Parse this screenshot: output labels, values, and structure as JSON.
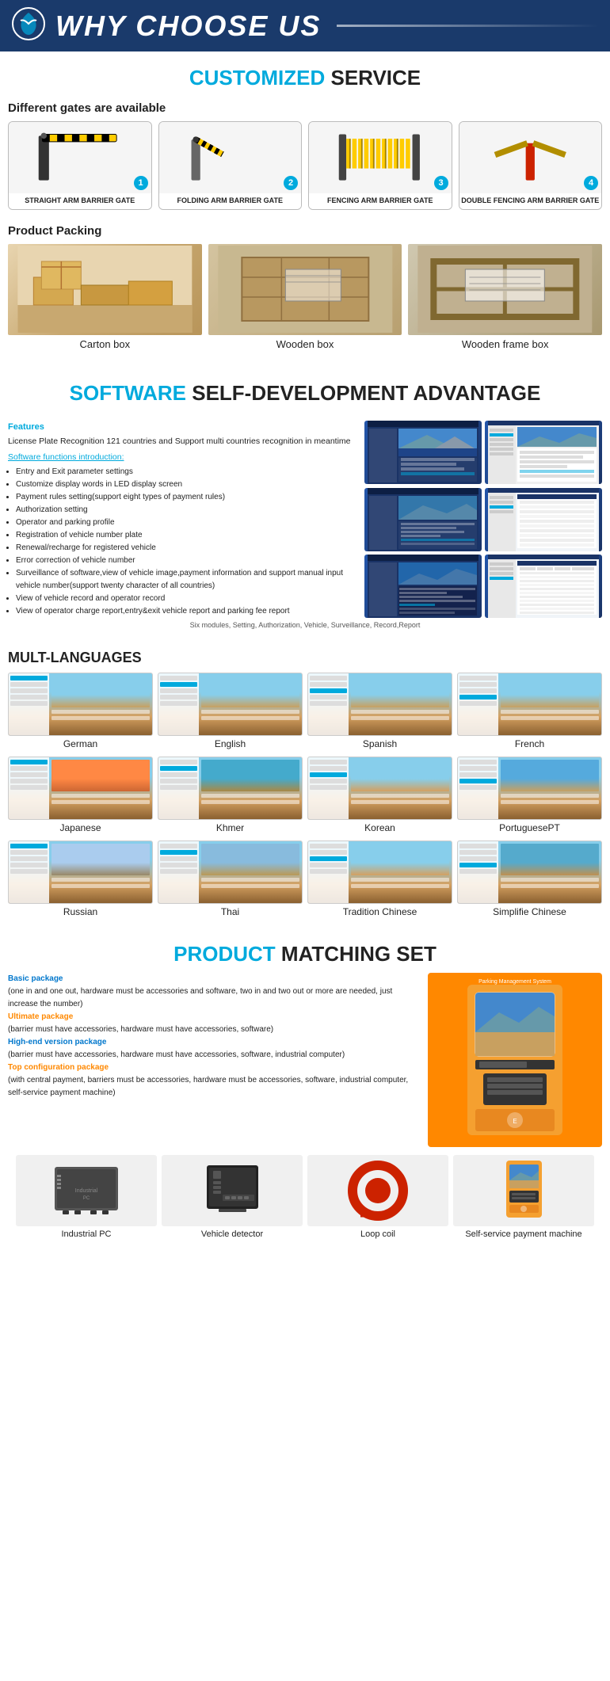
{
  "header": {
    "title": "WHY CHOOSE US",
    "logo_alt": "logo-icon"
  },
  "customized_service": {
    "section_title_highlight": "CUSTOMIZED",
    "section_title_normal": " SERVICE",
    "sub_title": "Different gates are available",
    "gates": [
      {
        "num": "1",
        "label": "STRAIGHT ARM BARRIER GATE"
      },
      {
        "num": "2",
        "label": "FOLDING ARM BARRIER GATE"
      },
      {
        "num": "3",
        "label": "FENCING ARM BARRIER GATE"
      },
      {
        "num": "4",
        "label": "DOUBLE FENCING ARM BARRIER GATE"
      }
    ],
    "packing_title": "Product Packing",
    "packing_items": [
      {
        "label": "Carton box"
      },
      {
        "label": "Wooden box"
      },
      {
        "label": "Wooden frame box"
      }
    ]
  },
  "software": {
    "section_title_highlight": "SOFTWARE",
    "section_title_normal": " SELF-DEVELOPMENT ADVANTAGE",
    "features_title": "Features",
    "features_desc": "License Plate Recognition 121 countries and Support multi countries recognition in meantime",
    "intro_label": "Software functions introduction:",
    "functions": [
      "Entry and Exit parameter settings",
      "Customize display words in LED display screen",
      "Payment rules setting(support eight types of payment rules)",
      "Authorization setting",
      "Operator and parking profile",
      "Registration of vehicle number plate",
      "Renewal/recharge for registered vehicle",
      "Error correction of vehicle number",
      "Surveillance of software,view of vehicle image,payment information and support manual input vehicle number(support twenty character of all countries)",
      "View of vehicle record and operator record",
      "View of operator charge report,entry&exit vehicle report and parking fee report"
    ],
    "caption": "Six modules, Setting, Authorization, Vehicle, Surveillance, Record,Report"
  },
  "languages": {
    "section_title": "MULT-LANGUAGES",
    "items": [
      "German",
      "English",
      "Spanish",
      "French",
      "Japanese",
      "Khmer",
      "Korean",
      "PortuguesePT",
      "Russian",
      "Thai",
      "Tradition Chinese",
      "Simplifie Chinese"
    ]
  },
  "product_matching": {
    "section_title_highlight": "PRODUCT",
    "section_title_normal": " MATCHING SET",
    "packages": [
      {
        "title": "Basic package",
        "color": "blue",
        "desc": "(one in and one out, hardware must be accessories and software, two in and two out or more are needed, just increase the number)"
      },
      {
        "title": "Ultimate package",
        "color": "orange",
        "desc": "(barrier must have accessories, hardware must have accessories, software)"
      },
      {
        "title": "High-end version package",
        "color": "blue",
        "desc": "(barrier must have accessories, hardware must have accessories, software, industrial computer)"
      },
      {
        "title": "Top configuration package",
        "color": "orange",
        "desc": "(with central payment, barriers must be accessories, hardware must be accessories, software, industrial computer, self-service payment machine)"
      }
    ],
    "bottom_items": [
      {
        "label": "Industrial PC"
      },
      {
        "label": "Vehicle detector"
      },
      {
        "label": "Loop coil"
      },
      {
        "label": "Self-service payment machine"
      }
    ]
  }
}
